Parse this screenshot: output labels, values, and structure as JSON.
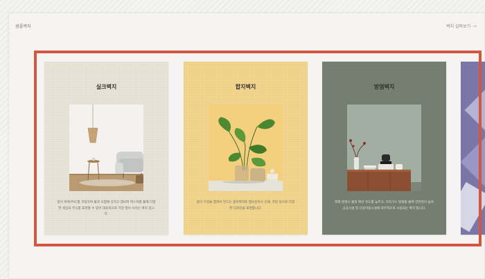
{
  "header": {
    "title": "샘플벽지",
    "link_label": "벽지 살펴보기",
    "link_arrow": "→"
  },
  "cards": [
    {
      "title": "실크벽지",
      "description": "종이 위에 PVC를 코팅하여 물과 오염에 강하고 엠보와 텍스쳐를 통해 다양한 색상과 무늬를 표현할 수 있어 대중적으로 가장 많이 쓰이는 벽지 입니다.",
      "photo": "living-room-photo"
    },
    {
      "title": "합지벽지",
      "description": "종이 두장을 합쳐서 만드는 종이벽지로 엠보싱이나 인쇄, 코팅 등으로 다양한 디자인을 표현합니다.",
      "photo": "plant-vase-photo"
    },
    {
      "title": "방염벽지",
      "description": "화재 발생시 불의 확산 속도를 늦추고, 유독가스 발생을 줄여 안전성이 높아 공공시설 및 다중이용시설에 의무적으로 사용되는 벽지 입니다.",
      "photo": "sideboard-photo"
    }
  ],
  "colors": {
    "highlight": "#d4563f",
    "silk_bg": "#e9e4d8",
    "hanji_bg": "#f1d68f",
    "fabric_bg": "#707a6b"
  }
}
